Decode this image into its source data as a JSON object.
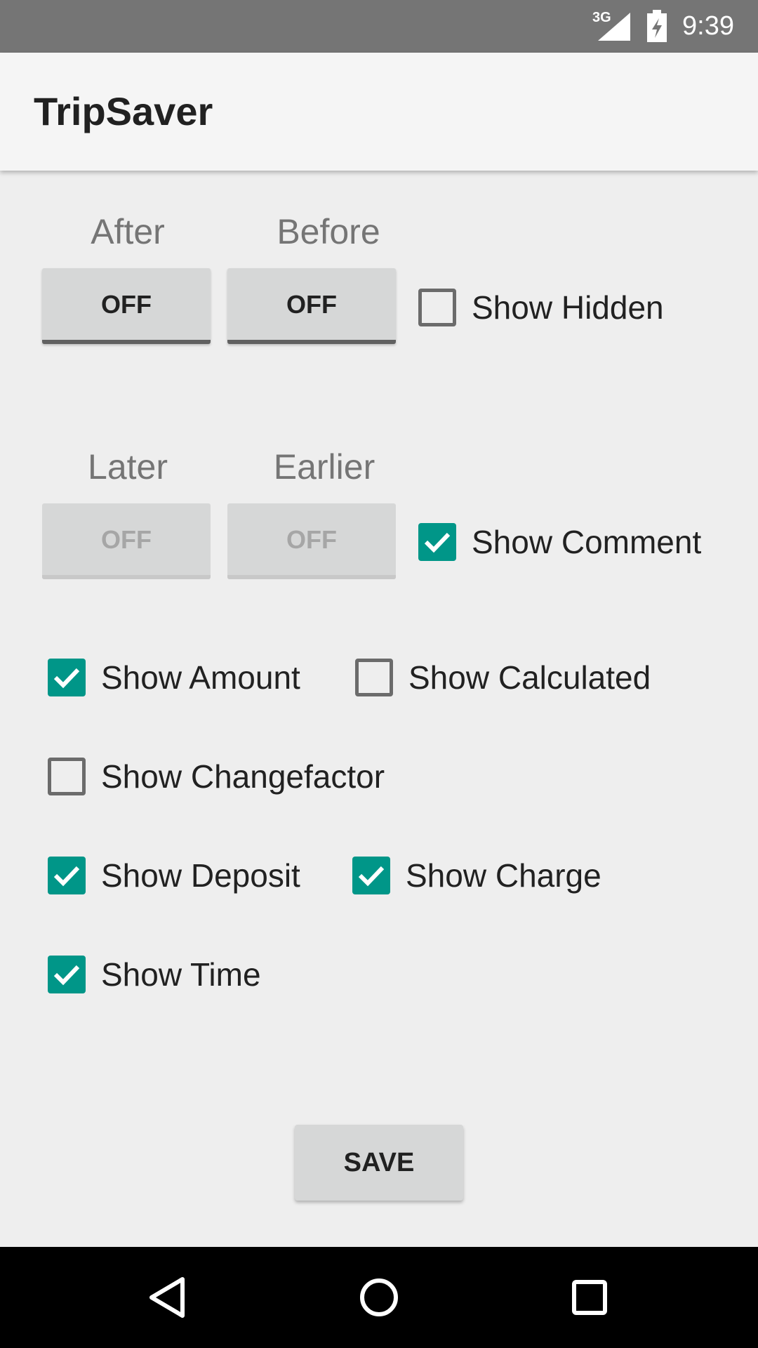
{
  "status_bar": {
    "network": "3G",
    "time": "9:39",
    "icons": [
      "signal-icon",
      "battery-charging-icon"
    ]
  },
  "app_bar": {
    "title": "TripSaver"
  },
  "filters": {
    "row1": {
      "after": {
        "caption": "After",
        "state": "OFF"
      },
      "before": {
        "caption": "Before",
        "state": "OFF"
      },
      "show_hidden": {
        "label": "Show Hidden",
        "checked": false
      }
    },
    "row2": {
      "later": {
        "caption": "Later",
        "state": "OFF",
        "enabled": false
      },
      "earlier": {
        "caption": "Earlier",
        "state": "OFF",
        "enabled": false
      },
      "show_comment": {
        "label": "Show Comment",
        "checked": true
      }
    }
  },
  "options": {
    "show_amount": {
      "label": "Show Amount",
      "checked": true
    },
    "show_calculated": {
      "label": "Show Calculated",
      "checked": false
    },
    "show_changefactor": {
      "label": "Show Changefactor",
      "checked": false
    },
    "show_deposit": {
      "label": "Show Deposit",
      "checked": true
    },
    "show_charge": {
      "label": "Show Charge",
      "checked": true
    },
    "show_time": {
      "label": "Show Time",
      "checked": true
    }
  },
  "actions": {
    "save_label": "SAVE"
  },
  "nav_bar": {
    "icons": [
      "back-icon",
      "home-icon",
      "recents-icon"
    ]
  },
  "colors": {
    "accent": "#009688",
    "status_bar": "#757575",
    "app_bar": "#f5f5f5",
    "background": "#eeeeee",
    "nav_bar": "#000000"
  }
}
